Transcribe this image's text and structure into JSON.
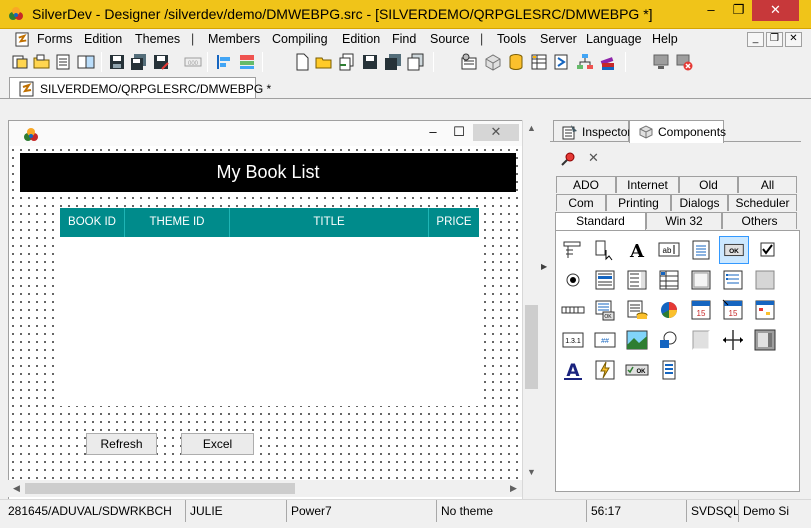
{
  "window": {
    "title": "SilverDev - Designer /silverdev/demo/DMWEBPG.src - [SILVERDEMO/QRPGLESRC/DMWEBPG *]",
    "min": "–",
    "max": "❐",
    "close": "✕"
  },
  "menu": [
    "Forms",
    "Edition",
    "Themes",
    "Members",
    "Compiling",
    "Edition",
    "Find",
    "Source",
    "Tools",
    "Server",
    "Language",
    "Help"
  ],
  "mdi": {
    "min": "_",
    "restore": "❐",
    "close": "✕"
  },
  "document_tab": {
    "label": "SILVERDEMO/QRPGLESRC/DMWEBPG *"
  },
  "designer": {
    "min": "–",
    "max": "☐",
    "close": "✕",
    "banner": "My Book List",
    "columns": [
      "BOOK ID",
      "THEME ID",
      "TITLE",
      "PRICE"
    ],
    "refresh_label": "Refresh",
    "excel_label": "Excel"
  },
  "panel": {
    "tabs": [
      "Inspector",
      "Components"
    ],
    "close": "✕",
    "category_tabs_row1": [
      "ADO",
      "Internet",
      "Old",
      "All"
    ],
    "category_tabs_row2": [
      "Com",
      "Printing",
      "Dialogs",
      "Scheduler"
    ],
    "category_tabs_row3": [
      "Standard",
      "Win 32",
      "Others"
    ],
    "components": [
      "main-menu-icon",
      "popup-menu-icon",
      "label-icon",
      "edit-icon",
      "memo-icon",
      "button-icon",
      "checkbox-icon",
      "radio-icon",
      "listbox-icon",
      "combobox-icon",
      "grid-icon",
      "panel-icon",
      "groupbox-icon",
      "shape-icon",
      "scrollbar-icon",
      "dbnavigator-icon",
      "dataset-icon",
      "database-icon",
      "chart-icon",
      "calendar-icon",
      "date-picker-icon",
      "schedule-icon",
      "version-icon",
      "mask-edit-icon",
      "image-icon",
      "shape-draw-icon",
      "bevel-icon",
      "splitter-icon",
      "frame-icon",
      "font-label-icon",
      "action-icon",
      "ok-button-icon",
      "list-icon"
    ],
    "selected_component": "button-icon"
  },
  "status": {
    "job": "281645/ADUVAL/SDWRKBCH",
    "user": "JULIE",
    "server": "Power7",
    "theme": "No theme",
    "cursor": "56:17",
    "connection": "SVDSQLF",
    "mode": "Demo Si"
  },
  "colors": {
    "title_bar": "#f0c419",
    "grid_header": "#008b8b",
    "close_button": "#c7383a"
  }
}
